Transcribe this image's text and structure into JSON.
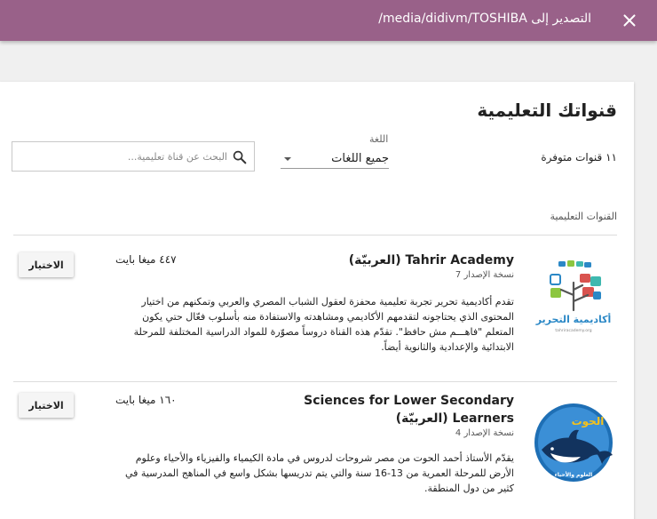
{
  "topbar": {
    "title": "التصدير إلى media/didivm/TOSHIBA/"
  },
  "page": {
    "title": "قنواتك التعليمية",
    "channel_count": "١١ قنوات متوفرة",
    "section_label": "القنوات التعليمية"
  },
  "filter": {
    "language_label": "اللغة",
    "language_value": "جميع اللغات"
  },
  "search": {
    "placeholder": "البحث عن قناة تعليمية..."
  },
  "channels": [
    {
      "name": "Tahrir Academy (العربيّة)",
      "version": "نسخة الإصدار 7",
      "size": "٤٤٧ ميغا بايت",
      "description": "تقدم أكاديمية تحرير تجربة تعليمية محفزة لعقول الشباب المصري والعربي وتمكنهم من اختيار المحتوى الذي يحتاجونه لتقدمهم الأكاديمي ومشاهدته والاستفادة منه بأسلوب فعّال حتي يكون المتعلم \"فاهـــم مش حافظ\". تقدّم هذه القناة دروساً مصوّرة للمواد الدراسية المختلفة للمرحلة الابتدائية والإعدادية والثانوية أيضاً.",
      "button": "الاختيار",
      "logo_text": "أكاديمية التحرير",
      "logo_url": "tahriracademy.org"
    },
    {
      "name": "Sciences for Lower Secondary Learners (العربيّة)",
      "version": "نسخة الإصدار 4",
      "size": "١٦٠ ميغا بايت",
      "description": "يقدّم الأستاذ أحمد الحوت من مصر شروحات لدروس في مادة الكيمياء والفيزياء والأحياء وعلوم الأرض للمرحلة العمرية من 13-16 سنة والتي يتم تدريسها بشكل واسع في المناهج المدرسية في كثير من دول المنطقة.",
      "button": "الاختيار",
      "logo_text": "الحوت",
      "logo_subtext": "العلوم والأحياء"
    }
  ],
  "colors": {
    "topbar": "#996189",
    "tahrir_green": "#8cc63f",
    "tahrir_blue": "#2b88c6",
    "tahrir_red": "#d9534f",
    "tahrir_teal": "#3fb8af",
    "hoot_blue": "#1e6fb5",
    "hoot_yellow": "#f5c21b"
  },
  "icons": {
    "close": "close-icon",
    "search": "search-icon",
    "dropdown": "chevron-down-icon"
  }
}
